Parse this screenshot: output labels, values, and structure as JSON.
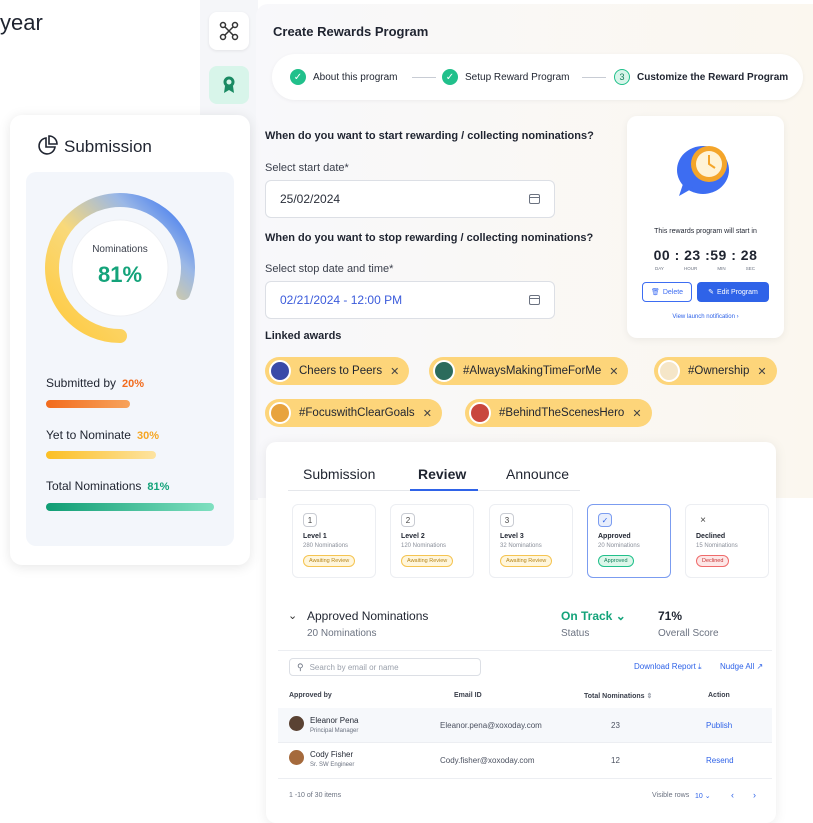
{
  "background_text": "year",
  "main": {
    "title": "Create Rewards Program",
    "steps": [
      {
        "label": "About this program",
        "state": "done"
      },
      {
        "label": "Setup Reward Program",
        "state": "done"
      },
      {
        "number": "3",
        "label": "Customize the Reward Program",
        "state": "active"
      }
    ],
    "start_question": "When do you want to start rewarding / collecting nominations?",
    "start_label": "Select start date*",
    "start_value": "25/02/2024",
    "stop_question": "When do you want to stop rewarding / collecting nominations?",
    "stop_label": "Select stop date and time*",
    "stop_value": "02/21/2024 - 12:00 PM",
    "linked_label": "Linked awards",
    "awards": [
      "Cheers to Peers",
      "#AlwaysMakingTimeForMe",
      "#Ownership",
      "#FocuswithClearGoals",
      "#BehindTheScenesHero"
    ]
  },
  "countdown": {
    "caption": "This rewards program will start in",
    "time": "00 : 23 :59 : 28",
    "units": [
      "DAY",
      "HOUR",
      "MIN",
      "SEC"
    ],
    "delete_label": "Delete",
    "edit_label": "Edit Program",
    "link_label": "View launch notification"
  },
  "submission": {
    "title": "Submission",
    "gauge_label": "Nominations",
    "gauge_value": "81%",
    "gauge_fraction": 0.81,
    "rows": [
      {
        "label": "Submitted by",
        "value": "20%",
        "fraction": 0.2,
        "color": "#f26b1d"
      },
      {
        "label": "Yet to Nominate",
        "value": "30%",
        "fraction": 0.3,
        "color": "#fbbf24"
      },
      {
        "label": "Total Nominations",
        "value": "81%",
        "fraction": 0.81,
        "color": "#14b88a"
      }
    ]
  },
  "review": {
    "tabs": [
      "Submission",
      "Review",
      "Announce"
    ],
    "active_tab": "Review",
    "levels": [
      {
        "n": "1",
        "title": "Level 1",
        "sub": "280 Nominations",
        "badge": "Awaiting Review",
        "kind": "await"
      },
      {
        "n": "2",
        "title": "Level 2",
        "sub": "120 Nominations",
        "badge": "Awaiting Review",
        "kind": "await"
      },
      {
        "n": "3",
        "title": "Level 3",
        "sub": "32 Nominations",
        "badge": "Awaiting Review",
        "kind": "await"
      },
      {
        "n": "✓",
        "title": "Approved",
        "sub": "20 Nominations",
        "badge": "Approved",
        "kind": "approved"
      },
      {
        "n": "×",
        "title": "Declined",
        "sub": "15 Nominations",
        "badge": "Declined",
        "kind": "declined"
      }
    ],
    "section_title": "Approved Nominations",
    "section_sub": "20 Nominations",
    "status_value": "On Track",
    "status_label": "Status",
    "score_value": "71%",
    "score_label": "Overall Score",
    "search_placeholder": "Search by email or name",
    "download_label": "Download Report",
    "nudge_label": "Nudge All",
    "columns": [
      "Approved by",
      "Email ID",
      "Total Nominations",
      "Action"
    ],
    "rows": [
      {
        "name": "Eleanor Pena",
        "role": "Principal Manager",
        "email": "Eleanor.pena@xoxoday.com",
        "total": "23",
        "action": "Publish"
      },
      {
        "name": "Cody Fisher",
        "role": "Sr. SW Engineer",
        "email": "Cody.fisher@xoxoday.com",
        "total": "12",
        "action": "Resend"
      }
    ],
    "pager": "1 -10 of 30 items",
    "visible_rows_label": "Visible rows",
    "visible_rows_value": "10"
  }
}
